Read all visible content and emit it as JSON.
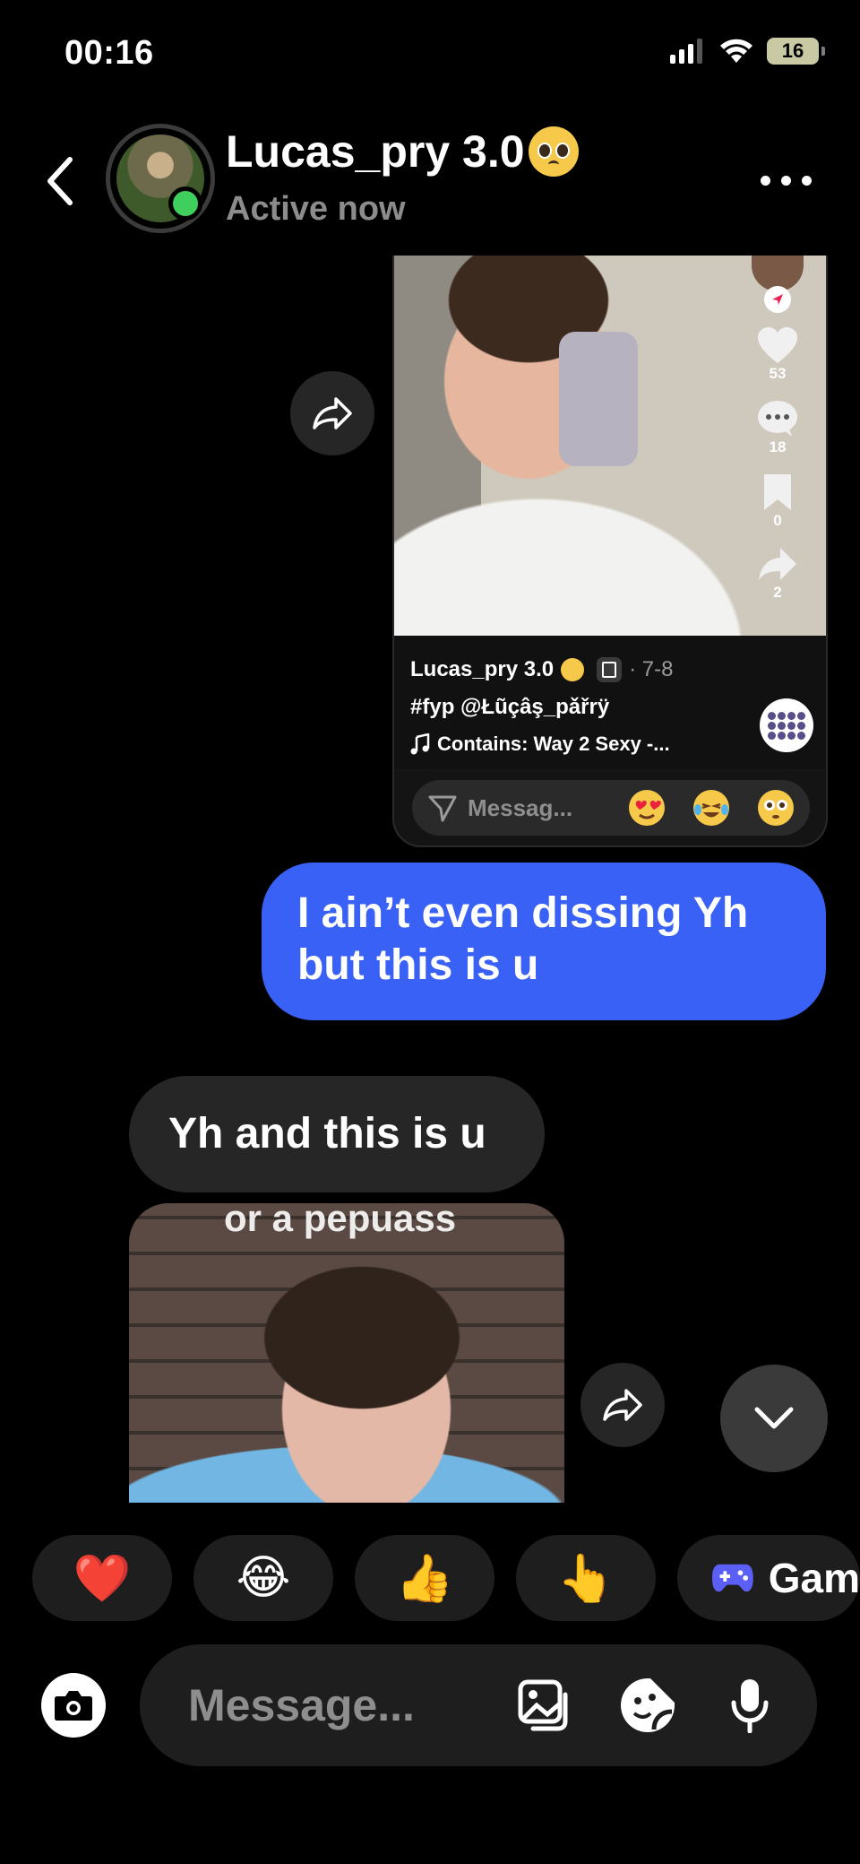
{
  "status_bar": {
    "time": "00:16",
    "battery": "16"
  },
  "header": {
    "title": "Lucas_pry 3.0",
    "title_emoji": "pleading-face",
    "subtitle": "Active now"
  },
  "shared_post": {
    "likes": "53",
    "comments": "18",
    "saves": "0",
    "shares": "2",
    "username": "Lucas_pry 3.0",
    "date": "· 7-8",
    "caption": "#fyp @Łũçâş_pǎřrÿ",
    "music": "Contains: Way 2 Sexy -...",
    "reply_placeholder": "Messag..."
  },
  "messages": [
    {
      "direction": "outgoing",
      "text": "I ain’t even dissing Yh but this is u"
    },
    {
      "direction": "incoming",
      "text": "Yh and this is u"
    }
  ],
  "video_reply": {
    "caption_fragment": "or a pepuass"
  },
  "quick_reactions": [
    "❤️",
    "😂",
    "👍",
    "👆"
  ],
  "games_label": "Gam",
  "composer": {
    "placeholder": "Message..."
  },
  "colors": {
    "outgoing_bubble": "#3a61f5",
    "incoming_bubble": "#262626",
    "online": "#3fcf5c"
  }
}
